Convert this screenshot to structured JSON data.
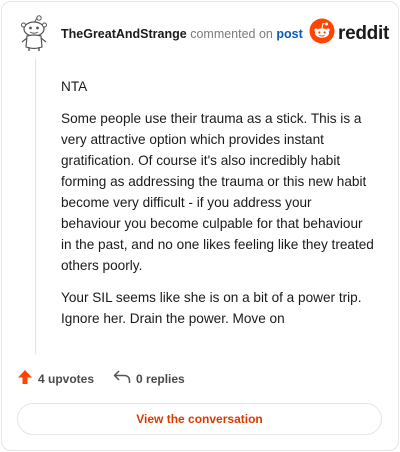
{
  "comment": {
    "username": "TheGreatAndStrange",
    "commented_text": "commented on",
    "post_link": "post",
    "paragraphs": [
      "NTA",
      "Some people use their trauma as a stick. This is a very attractive option which provides instant gratification. Of course it's also incredibly habit forming as addressing the trauma or this new habit become very difficult - if you address your behaviour you become culpable for that behaviour in the past, and no one likes feeling like they treated others poorly.",
      "Your SIL seems like she is on a bit of a power trip. Ignore her. Drain the power. Move on"
    ]
  },
  "brand": {
    "logo_text": "reddit",
    "accent": "#ff4500"
  },
  "actions": {
    "upvotes": "4 upvotes",
    "replies": "0 replies",
    "view_conversation": "View the conversation"
  },
  "icons": [
    "snoo-avatar-icon",
    "reddit-logo-icon",
    "upvote-arrow-icon",
    "reply-arrow-icon"
  ]
}
